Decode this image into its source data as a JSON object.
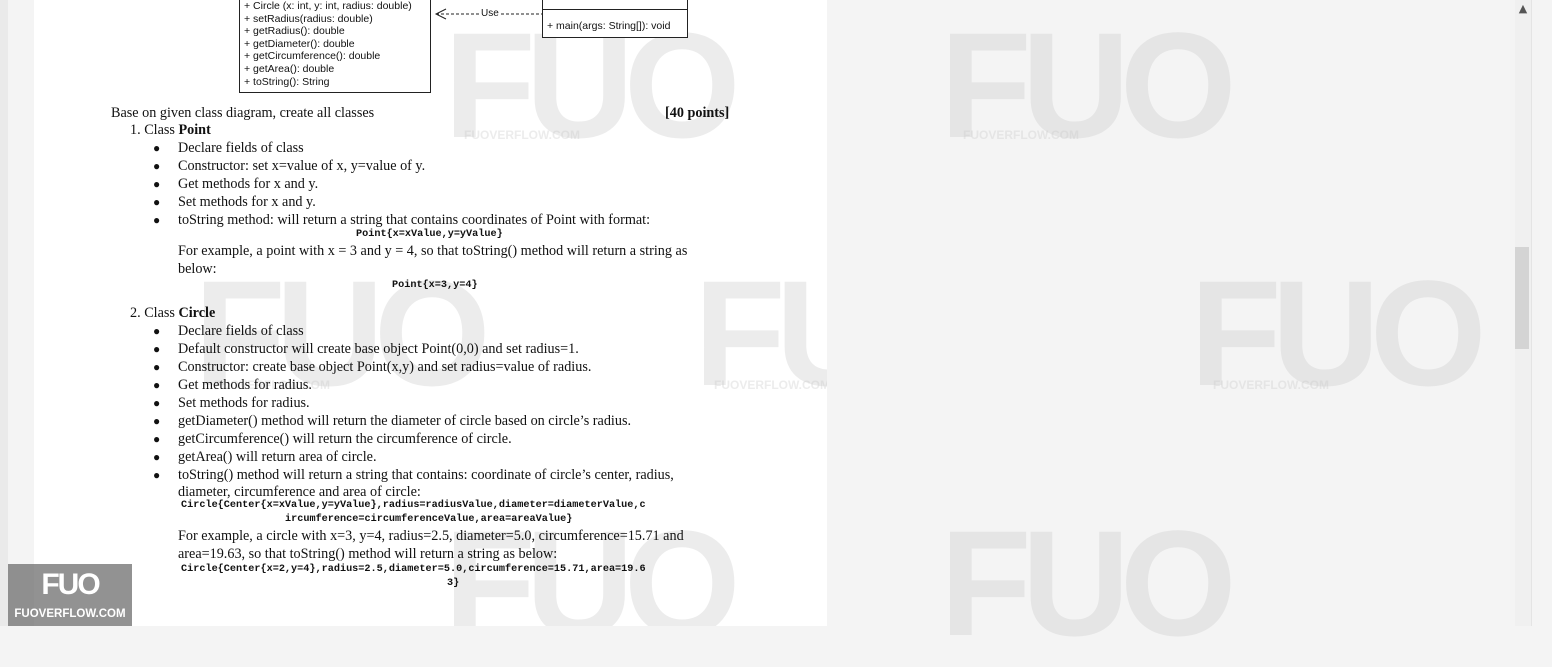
{
  "uml": {
    "circle_methods": [
      "+ Circle (x: int, y: int, radius: double)",
      "+ setRadius(radius: double)",
      "+ getRadius(): double",
      "+ getDiameter(): double",
      "+ getCircumference(): double",
      "+ getArea(): double",
      "+ toString(): String"
    ],
    "use_label": "Use",
    "main_method": "+ main(args: String[]): void"
  },
  "task": {
    "intro": "Base on given class diagram, create all classes",
    "points": "[40 points]"
  },
  "point_section": {
    "heading_prefix": "1. Class ",
    "heading_name": "Point",
    "bullets": [
      "Declare fields of class",
      "Constructor: set x=value of x, y=value of y.",
      "Get methods for x and y.",
      "Set methods for x and y.",
      "toString method: will return a string that contains coordinates of Point with format:"
    ],
    "format": "Point{x=xValue,y=yValue}",
    "example_line1": "For example, a point with x = 3 and y = 4, so that toString() method will return a string as",
    "example_line2": "below:",
    "example_output": "Point{x=3,y=4}"
  },
  "circle_section": {
    "heading_prefix": "2. Class ",
    "heading_name": "Circle",
    "bullets": [
      "Declare fields of class",
      "Default constructor will create base object Point(0,0) and set radius=1.",
      "Constructor: create base object Point(x,y) and set radius=value of radius.",
      "Get methods for radius.",
      "Set methods for radius.",
      "getDiameter() method will return the diameter of circle based on circle’s radius.",
      "getCircumference() will return the circumference of circle.",
      "getArea() will return area of circle.",
      "toString() method will return a string that contains: coordinate of circle’s center, radius,"
    ],
    "tostring_line2": "diameter, circumference and area of circle:",
    "format_line1": "Circle{Center{x=xValue,y=yValue},radius=radiusValue,diameter=diameterValue,c",
    "format_line2": "ircumference=circumferenceValue,area=areaValue}",
    "example_line1": "For example, a circle with x=3, y=4, radius=2.5, diameter=5.0, circumference=15.71 and",
    "example_line2": "area=19.63, so that toString() method will return a string as below:",
    "output_line1": "Circle{Center{x=2,y=4},radius=2.5,diameter=5.0,circumference=15.71,area=19.6",
    "output_line2": "3}"
  },
  "watermark": {
    "big": "FUO",
    "small": "FUOVERFLOW.COM"
  },
  "logo": {
    "big": "FUO",
    "small": "FUOVERFLOW.COM"
  },
  "scrollbar": {
    "up_icon": "▲"
  }
}
